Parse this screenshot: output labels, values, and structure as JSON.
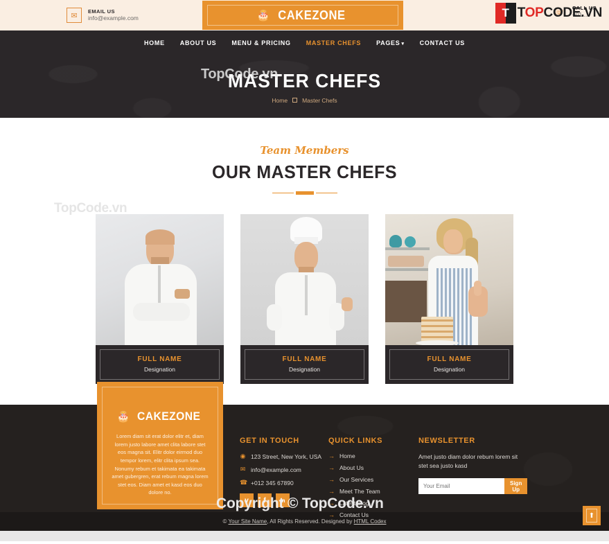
{
  "topbar": {
    "email": {
      "icon": "envelope-icon",
      "label": "EMAIL US",
      "value": "info@example.com"
    },
    "phone": {
      "icon": "phone-ring-icon",
      "label": "CALL US",
      "value": "+01..."
    },
    "logo": {
      "icon": "birthday-cake-icon",
      "text": "CAKEZONE"
    }
  },
  "watermark": {
    "brand_top": "TOPCODE.VN",
    "brand_top_prefix": "T",
    "hero": "TopCode.vn",
    "team": "TopCode.vn",
    "copyright": "Copyright © TopCode.vn"
  },
  "nav": {
    "items": [
      {
        "label": "HOME",
        "active": false
      },
      {
        "label": "ABOUT US",
        "active": false
      },
      {
        "label": "MENU & PRICING",
        "active": false
      },
      {
        "label": "MASTER CHEFS",
        "active": true
      },
      {
        "label": "PAGES",
        "active": false,
        "caret": "▾"
      },
      {
        "label": "CONTACT US",
        "active": false
      }
    ]
  },
  "hero": {
    "title": "MASTER CHEFS",
    "breadcrumb": {
      "home": "Home",
      "separator": "square-icon",
      "current": "Master Chefs"
    }
  },
  "team": {
    "subtitle": "Team Members",
    "title": "OUR MASTER CHEFS",
    "cards": [
      {
        "photo": "chef-bald-arms-crossed",
        "name": "FULL NAME",
        "designation": "Designation"
      },
      {
        "photo": "chef-with-toque-hat",
        "name": "FULL NAME",
        "designation": "Designation"
      },
      {
        "photo": "female-baker-thumbs-up",
        "name": "FULL NAME",
        "designation": "Designation"
      }
    ]
  },
  "footer": {
    "logo": {
      "icon": "birthday-cake-icon",
      "text": "CAKEZONE"
    },
    "about": "Lorem diam sit erat dolor elitr et, diam lorem justo labore amet clita labore stet eos magna sit. Elitr dolor eirmod duo tempor lorem, elitr clita ipsum sea. Nonumy rebum et takimata ea takimata amet gubergren, erat rebum magna lorem stet eos. Diam amet et kasd eos duo dolore no.",
    "get_in_touch": {
      "heading": "GET IN TOUCH",
      "address": "123 Street, New York, USA",
      "email": "info@example.com",
      "phone": "+012 345 67890",
      "socials": [
        {
          "name": "twitter-icon",
          "glyph": "ᴠ"
        },
        {
          "name": "facebook-icon",
          "glyph": "f"
        },
        {
          "name": "linkedin-icon",
          "glyph": "in"
        }
      ]
    },
    "quick_links": {
      "heading": "QUICK LINKS",
      "items": [
        "Home",
        "About Us",
        "Our Services",
        "Meet The Team",
        "Latest Blog",
        "Contact Us"
      ]
    },
    "newsletter": {
      "heading": "NEWSLETTER",
      "text": "Amet justo diam dolor rebum lorem sit stet sea justo kasd",
      "placeholder": "Your Email",
      "button": "Sign Up"
    }
  },
  "copyright": {
    "prefix": "© ",
    "site": "Your Site Name",
    "middle": ", All Rights Reserved. Designed by ",
    "designer": "HTML Codex"
  },
  "back_to_top": {
    "icon": "arrow-up-icon",
    "glyph": "⬆"
  },
  "colors": {
    "accent": "#e8922e",
    "dark": "#2b2729",
    "footer_dark": "#25211f",
    "copy_dark": "#1c1918",
    "topbar_bg": "#faeee2",
    "watermark_red": "#e02a26"
  }
}
